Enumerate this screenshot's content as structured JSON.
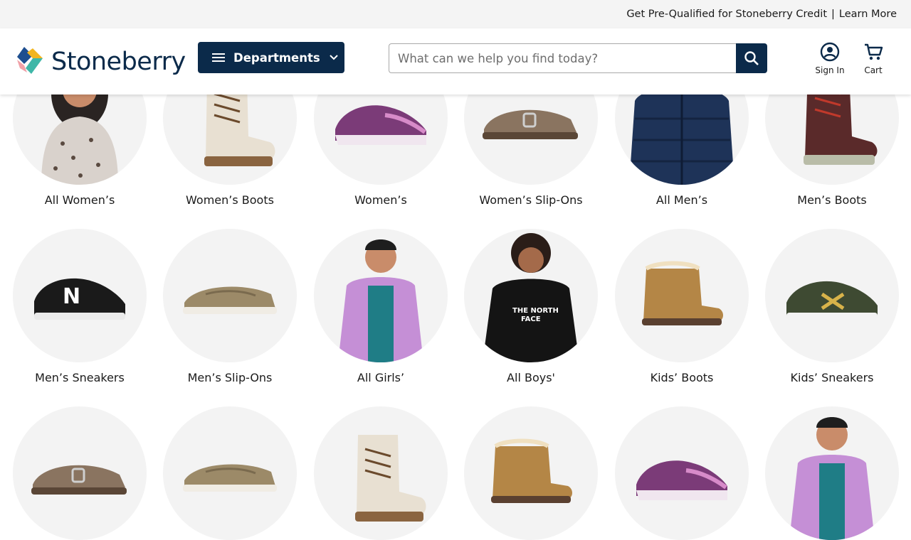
{
  "promo": {
    "text": "Get Pre-Qualified for Stoneberry Credit",
    "separator": "|",
    "link": "Learn More"
  },
  "header": {
    "logo": "Stoneberry",
    "departments_label": "Departments",
    "search": {
      "placeholder": "What can we help you find today?",
      "value": ""
    },
    "signin_label": "Sign In",
    "cart_label": "Cart"
  },
  "colors": {
    "navy": "#0b2a4a",
    "promo_bg": "#f4f4f4",
    "tile_bg": "#f3f3f3",
    "logo_blue": "#1d4e8f",
    "logo_yellow": "#f2b51f",
    "logo_teal": "#3fb7a8",
    "logo_pink": "#f0a1a8"
  },
  "categories": [
    {
      "label": "All Women’s",
      "icon": "woman-leopard-top-image"
    },
    {
      "label": "Women’s Boots",
      "icon": "winter-boot-image"
    },
    {
      "label": "Women’s",
      "icon": "purple-sneaker-image"
    },
    {
      "label": "Women’s Slip-Ons",
      "icon": "clog-image"
    },
    {
      "label": "All Men’s",
      "icon": "navy-puffer-jacket-image"
    },
    {
      "label": "Men’s Boots",
      "icon": "hiking-boot-image"
    },
    {
      "label": "Men’s Sneakers",
      "icon": "black-sneaker-image"
    },
    {
      "label": "Men’s Slip-Ons",
      "icon": "canvas-slip-on-image"
    },
    {
      "label": "All Girls’",
      "icon": "girl-purple-jacket-image"
    },
    {
      "label": "All Boys'",
      "icon": "boy-black-hoodie-image"
    },
    {
      "label": "Kids’ Boots",
      "icon": "tan-bootie-image"
    },
    {
      "label": "Kids’ Sneakers",
      "icon": "green-sneaker-image"
    },
    {
      "label": "",
      "icon": "clog-image"
    },
    {
      "label": "",
      "icon": "canvas-slip-on-image"
    },
    {
      "label": "",
      "icon": "winter-boot-image"
    },
    {
      "label": "",
      "icon": "tan-bootie-image"
    },
    {
      "label": "",
      "icon": "purple-sneaker-image"
    },
    {
      "label": "",
      "icon": "girl-purple-jacket-image"
    }
  ]
}
